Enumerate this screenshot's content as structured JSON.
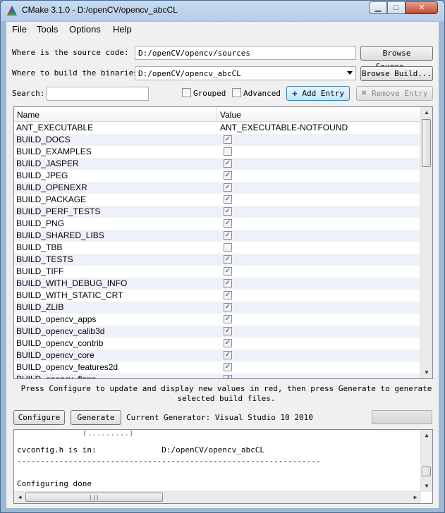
{
  "window": {
    "title": "CMake 3.1.0 - D:/openCV/opencv_abcCL",
    "minimize": "▁",
    "maximize": "□",
    "close": "✕"
  },
  "menu": [
    "File",
    "Tools",
    "Options",
    "Help"
  ],
  "source": {
    "label": "Where is the source code:",
    "value": "D:/openCV/opencv/sources",
    "browse": "Browse Source..."
  },
  "build": {
    "label": "Where to build the binaries:",
    "value": "D:/openCV/opencv_abcCL",
    "browse": "Browse Build..."
  },
  "search": {
    "label": "Search:",
    "value": ""
  },
  "toggles": {
    "grouped": "Grouped",
    "advanced": "Advanced"
  },
  "actions": {
    "add_entry": "Add Entry",
    "remove_entry": "Remove Entry"
  },
  "table": {
    "headers": [
      "Name",
      "Value"
    ],
    "rows": [
      {
        "name": "ANT_EXECUTABLE",
        "value": "ANT_EXECUTABLE-NOTFOUND"
      },
      {
        "name": "BUILD_DOCS",
        "checked": true
      },
      {
        "name": "BUILD_EXAMPLES",
        "checked": false
      },
      {
        "name": "BUILD_JASPER",
        "checked": true
      },
      {
        "name": "BUILD_JPEG",
        "checked": true
      },
      {
        "name": "BUILD_OPENEXR",
        "checked": true
      },
      {
        "name": "BUILD_PACKAGE",
        "checked": true
      },
      {
        "name": "BUILD_PERF_TESTS",
        "checked": true
      },
      {
        "name": "BUILD_PNG",
        "checked": true
      },
      {
        "name": "BUILD_SHARED_LIBS",
        "checked": true
      },
      {
        "name": "BUILD_TBB",
        "checked": false
      },
      {
        "name": "BUILD_TESTS",
        "checked": true
      },
      {
        "name": "BUILD_TIFF",
        "checked": true
      },
      {
        "name": "BUILD_WITH_DEBUG_INFO",
        "checked": true
      },
      {
        "name": "BUILD_WITH_STATIC_CRT",
        "checked": true
      },
      {
        "name": "BUILD_ZLIB",
        "checked": true
      },
      {
        "name": "BUILD_opencv_apps",
        "checked": true
      },
      {
        "name": "BUILD_opencv_calib3d",
        "checked": true
      },
      {
        "name": "BUILD_opencv_contrib",
        "checked": true
      },
      {
        "name": "BUILD_opencv_core",
        "checked": true
      },
      {
        "name": "BUILD_opencv_features2d",
        "checked": true
      },
      {
        "name": "BUILD_opencv_flann",
        "checked": true
      }
    ]
  },
  "hint": "Press Configure to update and display new values in red, then press Generate to generate selected build files.",
  "bottom": {
    "configure": "Configure",
    "generate": "Generate",
    "generator": "Current Generator: Visual Studio 10 2010"
  },
  "output": {
    "lines": [
      "cvconfig.h is in:              D:/openCV/opencv_abcCL",
      "-----------------------------------------------------------------",
      "",
      "Configuring done"
    ]
  }
}
